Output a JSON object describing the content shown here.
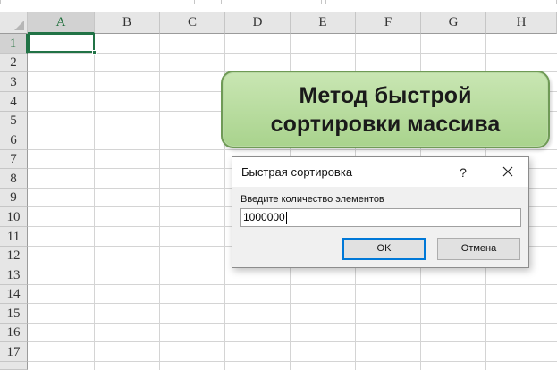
{
  "spreadsheet": {
    "columns": [
      "A",
      "B",
      "C",
      "D",
      "E",
      "F",
      "G",
      "H"
    ],
    "rows": [
      "1",
      "2",
      "3",
      "4",
      "5",
      "6",
      "7",
      "8",
      "9",
      "10",
      "11",
      "12",
      "13",
      "14",
      "15",
      "16",
      "17"
    ],
    "selected_cell": "A1",
    "accent_color": "#217346"
  },
  "shape": {
    "title": "Метод быстрой сортировки массива",
    "fill_color": "#b5db9a"
  },
  "dialog": {
    "title": "Быстрая сортировка",
    "help_label": "?",
    "prompt": "Введите количество элементов",
    "input_value": "1000000",
    "ok_label": "OK",
    "cancel_label": "Отмена"
  }
}
